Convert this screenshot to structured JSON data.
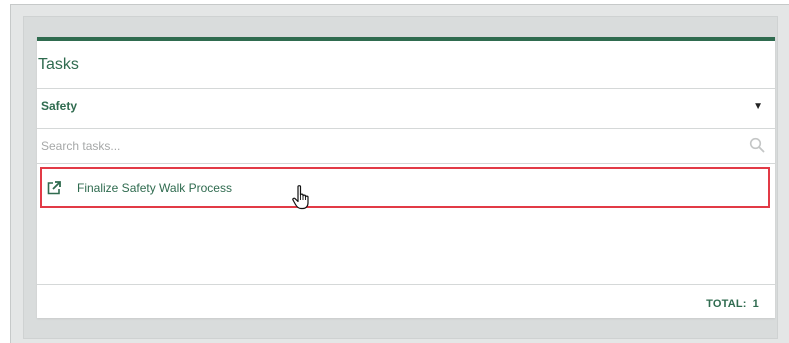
{
  "widget": {
    "title": "Tasks",
    "accent_color": "#2f6b4f"
  },
  "category": {
    "selected": "Safety",
    "caret": "▼"
  },
  "search": {
    "placeholder": "Search tasks...",
    "value": ""
  },
  "tasks": [
    {
      "label": "Finalize Safety Walk Process",
      "icon": "open-in-new-icon",
      "highlight_color": "#e23a46"
    }
  ],
  "footer": {
    "total_label": "TOTAL:",
    "total_value": "1"
  }
}
